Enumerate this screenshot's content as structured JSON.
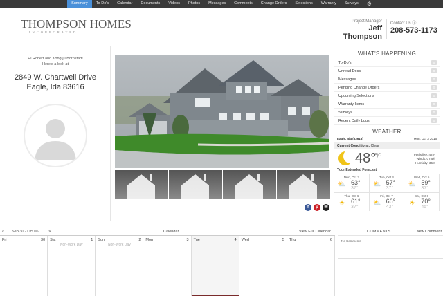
{
  "nav": {
    "items": [
      "Summary",
      "To-Do's",
      "Calendar",
      "Documents",
      "Videos",
      "Photos",
      "Messages",
      "Comments",
      "Change Orders",
      "Selections",
      "Warranty",
      "Surveys"
    ],
    "active": "Summary"
  },
  "header": {
    "brand": "THOMPSON HOMES",
    "brand_sub": "INCORPORATED",
    "pm_label": "Project Manager",
    "pm_name": "Jeff Thompson",
    "contact_label": "Contact Us ⓘ",
    "contact_phone": "208-573-1173"
  },
  "welcome": {
    "line1": "Hi Robert and Kong-ju Bornstad!",
    "line2": "Here's a look at",
    "address1": "2849 W. Chartwell Drive",
    "address2": "Eagle, Ida 83616"
  },
  "happening": {
    "title": "WHAT'S HAPPENING",
    "items": [
      {
        "label": "To-Do's",
        "count": "0"
      },
      {
        "label": "Unread Docs",
        "count": "0"
      },
      {
        "label": "Messages",
        "count": "0"
      },
      {
        "label": "Pending Change Orders",
        "count": "0"
      },
      {
        "label": "Upcoming Selections",
        "count": "0"
      },
      {
        "label": "Warranty Items",
        "count": "0"
      },
      {
        "label": "Surveys",
        "count": "0"
      },
      {
        "label": "Recent Daily Logs",
        "count": "0"
      }
    ]
  },
  "weather": {
    "title": "WEATHER",
    "location": "Eagle, Ida (83616)",
    "date": "Mon, Oct 3 2016",
    "current_label": "Current Conditions:",
    "current_cond": "Clear",
    "temp": "48°",
    "unit": "F|C",
    "feels": "Feels like: 48°F",
    "winds": "Winds: 0 mph",
    "humidity": "Humidity: 36%",
    "ext_label": "Your Extended Forecast",
    "forecast": [
      {
        "day": "Mon, Oct 3",
        "hi": "63°",
        "lo": "37°",
        "icon": "partly-cloudy-icon"
      },
      {
        "day": "Tue, Oct 4",
        "hi": "57°",
        "lo": "37°",
        "icon": "partly-cloudy-icon"
      },
      {
        "day": "Wed, Oct 5",
        "hi": "59°",
        "lo": "37°",
        "icon": "partly-cloudy-icon"
      },
      {
        "day": "Thu, Oct 6",
        "hi": "61°",
        "lo": "37°",
        "icon": "sunny-icon"
      },
      {
        "day": "Fri, Oct 7",
        "hi": "66°",
        "lo": "43°",
        "icon": "partly-cloudy-icon"
      },
      {
        "day": "Sat, Oct 8",
        "hi": "70°",
        "lo": "45°",
        "icon": "sunny-icon"
      }
    ]
  },
  "calendar": {
    "prev": "<",
    "range": "Sep 30 - Oct 06",
    "next": ">",
    "title": "Calendar",
    "view_full": "View Full Calendar",
    "days": [
      {
        "name": "Fri",
        "num": "30",
        "note": ""
      },
      {
        "name": "Sat",
        "num": "1",
        "note": "Non-Work Day"
      },
      {
        "name": "Sun",
        "num": "2",
        "note": "Non-Work Day"
      },
      {
        "name": "Mon",
        "num": "3",
        "note": ""
      },
      {
        "name": "Tue",
        "num": "4",
        "note": ""
      },
      {
        "name": "Wed",
        "num": "5",
        "note": ""
      },
      {
        "name": "Thu",
        "num": "6",
        "note": ""
      }
    ],
    "today_index": 4
  },
  "comments": {
    "title": "COMMENTS",
    "new": "New Comment",
    "empty": "No Comments"
  },
  "social": [
    "facebook-icon",
    "pinterest-icon",
    "email-icon"
  ]
}
